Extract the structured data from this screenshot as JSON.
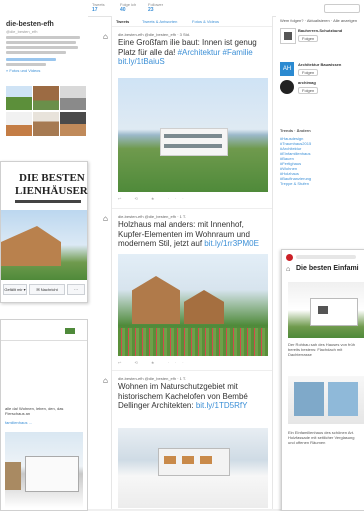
{
  "profile": {
    "name": "die-besten-efh",
    "handle": "@die_besten_efh",
    "display_name": "die-besten-efh",
    "tweets_link": "» Fotos und Videos"
  },
  "stats": [
    {
      "label": "Tweets",
      "value": "17"
    },
    {
      "label": "Folge ich",
      "value": "40"
    },
    {
      "label": "Follower",
      "value": "23"
    }
  ],
  "tabs": [
    "Tweets",
    "Tweets & Antworten",
    "Fotos & Videos"
  ],
  "tweets": [
    {
      "author": "die-besten-efh @die_besten_efh · 3 Std.",
      "text": "Eine Großfam ilie baut: Innen ist genug Platz für alle da! ",
      "tags": "#Architektur #Familie bit.ly/1tBaiuS"
    },
    {
      "author": "die-besten-efh @die_besten_efh · 1 T.",
      "text": "Holzhaus mal anders: mit Innenhof, Kupfer-Elementen im Wohnraum und modernem Stil, jetzt auf ",
      "tags": "bit.ly/1rr3PM0E"
    },
    {
      "author": "die-besten-efh @die_besten_efh · 1 T.",
      "text": "Wohnen im Naturschutzgebiet mit historischem Kachelofen von Bembé Dellinger Architekten: ",
      "tags": "bit.ly/1TD5RfY"
    }
  ],
  "who_to_follow": {
    "title": "Wem folgen? · Aktualisieren · Alle anzeigen",
    "accounts": [
      {
        "name": "Bauherren-Schutzbund",
        "follow": "Folgen",
        "badge": ""
      },
      {
        "name": "Architektur Bauwissen",
        "follow": "Folgen",
        "badge": "AH"
      },
      {
        "name": "archimag",
        "follow": "Folgen",
        "badge": ""
      }
    ]
  },
  "trends": {
    "title": "Trends · Ändern",
    "items": [
      "#Hausdesign",
      "#Traumhaus2015",
      "#Architektur",
      "#Einfamilienhaus",
      "#Bauen",
      "#Fertighaus",
      "#Wohnen",
      "#Holzhaus",
      "#Baufinanzierung",
      "Treppe & Stufen"
    ]
  },
  "panel_left": {
    "heading_line1": "DIE BESTEN",
    "heading_line2": "LIENHÄUSER",
    "message_label": "Nachricht",
    "more_label": "···",
    "follow_label": "Gefällt mir ▾"
  },
  "panel_bottom_left": {
    "text": "alle da! Wohnen, leben, den, das Fierschaus an",
    "link": "familienhaus ..."
  },
  "panel_right": {
    "title": "Die besten Einfami",
    "caption": "Der Rohbau sah des Hauses von früh bereits bestens: Flachdach mit Dachterrasse",
    "caption2": "Ein Einfamilienhaus des schönen Art. Holzfassade mit seitlicher Verglasung und offenen Räumen"
  },
  "colors": {
    "accent": "#3b8fd6",
    "sky": "#cfe3f5",
    "grass": "#4f8a3a",
    "wood": "#b07a4a"
  }
}
